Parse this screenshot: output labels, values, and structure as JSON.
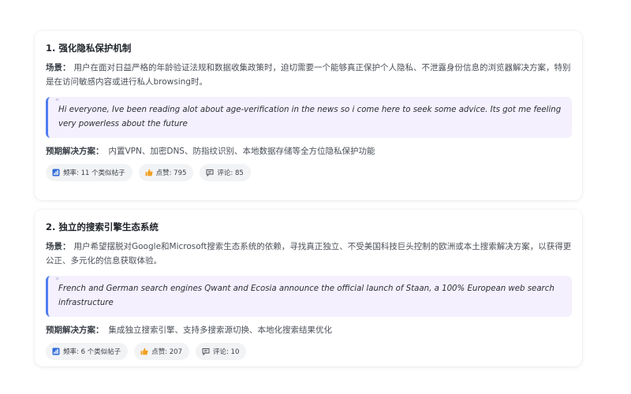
{
  "cards": [
    {
      "title": "1. 强化隐私保护机制",
      "scenario_label": "场景：",
      "scenario_text": "用户在面对日益严格的年龄验证法规和数据收集政策时，迫切需要一个能够真正保护个人隐私、不泄露身份信息的浏览器解决方案，特别是在访问敏感内容或进行私人browsing时。",
      "quote_mark": "\"",
      "quote": "Hi everyone, Ive been reading alot about age-verification in the news so i come here to seek some advice. Its got me feeling very powerless about the future",
      "solution_label": "预期解决方案：",
      "solution_text": "内置VPN、加密DNS、防指纹识别、本地数据存储等全方位隐私保护功能",
      "badges": {
        "frequency": "频率: 11 个类似帖子",
        "likes": "点赞: 795",
        "comments": "评论: 85"
      }
    },
    {
      "title": "2. 独立的搜索引擎生态系统",
      "scenario_label": "场景：",
      "scenario_text": "用户希望摆脱对Google和Microsoft搜索生态系统的依赖，寻找真正独立、不受美国科技巨头控制的欧洲或本土搜索解决方案，以获得更公正、多元化的信息获取体验。",
      "quote_mark": "\"",
      "quote": "French and German search engines Qwant and Ecosia announce the official launch of Staan, a 100% European web search infrastructure",
      "solution_label": "预期解决方案：",
      "solution_text": "集成独立搜索引擎、支持多搜索源切换、本地化搜索结果优化",
      "badges": {
        "frequency": "频率: 6 个类似帖子",
        "likes": "点赞: 207",
        "comments": "评论: 10"
      }
    }
  ],
  "icons": {
    "frequency": "frequency-chart-icon",
    "likes": "thumbs-up-icon",
    "comments": "comment-bubble-icon"
  },
  "colors": {
    "quote_background": "#f4f0fd",
    "quote_border": "#4f7cf0",
    "badge_background": "#f2f3f5",
    "frequency_icon": "#2f6bd8",
    "likes_icon": "#f0a020"
  }
}
